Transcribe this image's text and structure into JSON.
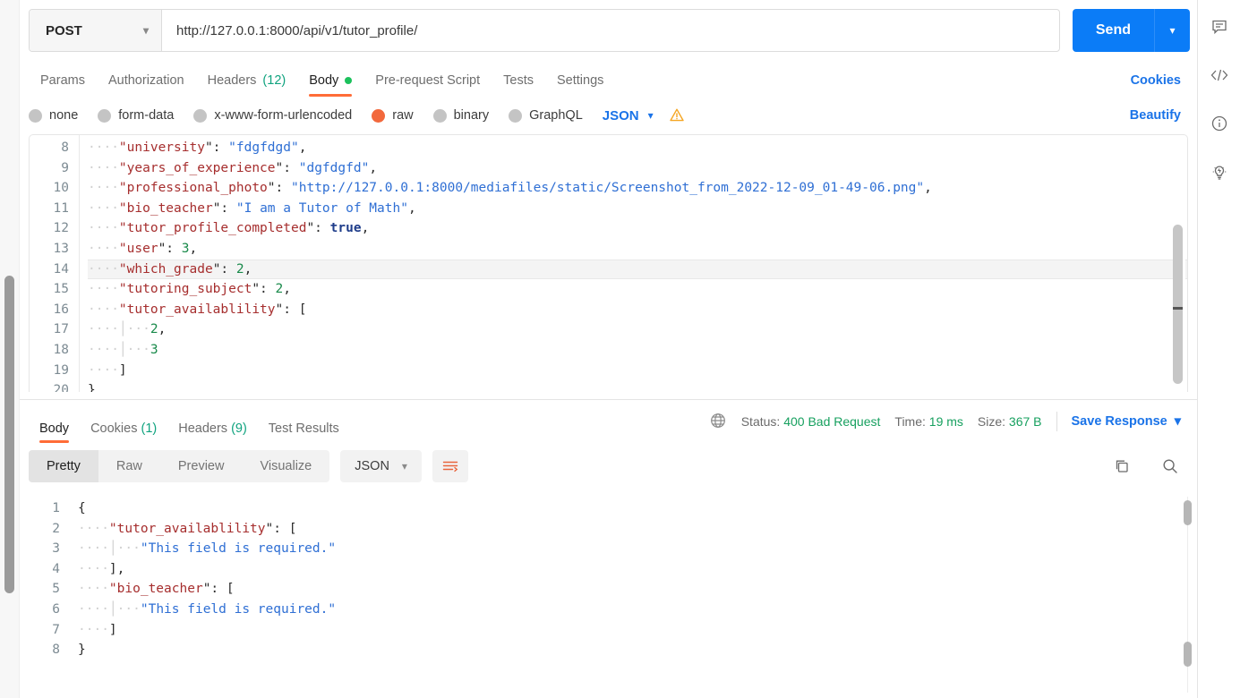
{
  "request": {
    "method": "POST",
    "url": "http://127.0.0.1:8000/api/v1/tutor_profile/",
    "send_label": "Send",
    "tabs": [
      {
        "label": "Params",
        "count": "",
        "active": false,
        "dot": false
      },
      {
        "label": "Authorization",
        "count": "",
        "active": false,
        "dot": false
      },
      {
        "label": "Headers",
        "count": "(12)",
        "active": false,
        "dot": false
      },
      {
        "label": "Body",
        "count": "",
        "active": true,
        "dot": true
      },
      {
        "label": "Pre-request Script",
        "count": "",
        "active": false,
        "dot": false
      },
      {
        "label": "Tests",
        "count": "",
        "active": false,
        "dot": false
      },
      {
        "label": "Settings",
        "count": "",
        "active": false,
        "dot": false
      }
    ],
    "cookies_link": "Cookies",
    "beautify_link": "Beautify",
    "body_types": [
      {
        "label": "none",
        "selected": false
      },
      {
        "label": "form-data",
        "selected": false
      },
      {
        "label": "x-www-form-urlencoded",
        "selected": false
      },
      {
        "label": "raw",
        "selected": true
      },
      {
        "label": "binary",
        "selected": false
      },
      {
        "label": "GraphQL",
        "selected": false
      }
    ],
    "raw_format": "JSON"
  },
  "editor": {
    "first_line": 8,
    "highlight_line": 14,
    "lines": [
      {
        "no": "8",
        "indent": 1,
        "key": "university",
        "sep": "\": ",
        "value": "\"fdgfdgd\"",
        "vtype": "s",
        "tail": ","
      },
      {
        "no": "9",
        "indent": 1,
        "key": "years_of_experience",
        "sep": "\": ",
        "value": "\"dgfdgfd\"",
        "vtype": "s",
        "tail": ","
      },
      {
        "no": "10",
        "indent": 1,
        "key": "professional_photo",
        "sep": "\": ",
        "value": "\"http://127.0.0.1:8000/mediafiles/static/Screenshot_from_2022-12-09_01-49-06.png\"",
        "vtype": "s",
        "tail": ","
      },
      {
        "no": "11",
        "indent": 1,
        "key": "bio_teacher",
        "sep": "\": ",
        "value": "\"I am a Tutor of Math\"",
        "vtype": "s",
        "tail": ","
      },
      {
        "no": "12",
        "indent": 1,
        "key": "tutor_profile_completed",
        "sep": "\": ",
        "value": "true",
        "vtype": "b",
        "tail": ","
      },
      {
        "no": "13",
        "indent": 1,
        "key": "user",
        "sep": "\": ",
        "value": "3",
        "vtype": "n",
        "tail": ","
      },
      {
        "no": "14",
        "indent": 1,
        "key": "which_grade",
        "sep": "\": ",
        "value": "2",
        "vtype": "n",
        "tail": ","
      },
      {
        "no": "15",
        "indent": 1,
        "key": "tutoring_subject",
        "sep": "\": ",
        "value": "2",
        "vtype": "n",
        "tail": ","
      },
      {
        "no": "16",
        "indent": 1,
        "key": "tutor_availablility",
        "sep": "\": ",
        "value": "[",
        "vtype": "p",
        "tail": ""
      },
      {
        "no": "17",
        "indent": 2,
        "key": "",
        "sep": "",
        "value": "2",
        "vtype": "n",
        "tail": ","
      },
      {
        "no": "18",
        "indent": 2,
        "key": "",
        "sep": "",
        "value": "3",
        "vtype": "n",
        "tail": ""
      },
      {
        "no": "19",
        "indent": 1,
        "key": "",
        "sep": "",
        "value": "]",
        "vtype": "p",
        "tail": ""
      },
      {
        "no": "20",
        "indent": 0,
        "key": "",
        "sep": "",
        "value": "}",
        "vtype": "p",
        "tail": ""
      }
    ]
  },
  "response": {
    "tabs": [
      {
        "label": "Body",
        "count": "",
        "active": true
      },
      {
        "label": "Cookies",
        "count": "(1)",
        "active": false
      },
      {
        "label": "Headers",
        "count": "(9)",
        "active": false
      },
      {
        "label": "Test Results",
        "count": "",
        "active": false
      }
    ],
    "status_label": "Status:",
    "status_value": "400 Bad Request",
    "time_label": "Time:",
    "time_value": "19 ms",
    "size_label": "Size:",
    "size_value": "367 B",
    "save_response": "Save Response",
    "view_modes": [
      {
        "label": "Pretty",
        "active": true
      },
      {
        "label": "Raw",
        "active": false
      },
      {
        "label": "Preview",
        "active": false
      },
      {
        "label": "Visualize",
        "active": false
      }
    ],
    "format": "JSON",
    "body_lines": [
      {
        "no": "1",
        "indent": 0,
        "key": "",
        "sep": "",
        "value": "{",
        "vtype": "p",
        "tail": ""
      },
      {
        "no": "2",
        "indent": 1,
        "key": "tutor_availablility",
        "sep": "\": ",
        "value": "[",
        "vtype": "p",
        "tail": ""
      },
      {
        "no": "3",
        "indent": 2,
        "key": "",
        "sep": "",
        "value": "\"This field is required.\"",
        "vtype": "s",
        "tail": ""
      },
      {
        "no": "4",
        "indent": 1,
        "key": "",
        "sep": "",
        "value": "]",
        "vtype": "p",
        "tail": ","
      },
      {
        "no": "5",
        "indent": 1,
        "key": "bio_teacher",
        "sep": "\": ",
        "value": "[",
        "vtype": "p",
        "tail": ""
      },
      {
        "no": "6",
        "indent": 2,
        "key": "",
        "sep": "",
        "value": "\"This field is required.\"",
        "vtype": "s",
        "tail": ""
      },
      {
        "no": "7",
        "indent": 1,
        "key": "",
        "sep": "",
        "value": "]",
        "vtype": "p",
        "tail": ""
      },
      {
        "no": "8",
        "indent": 0,
        "key": "",
        "sep": "",
        "value": "}",
        "vtype": "p",
        "tail": ""
      }
    ]
  },
  "rail": {
    "icons": [
      "comment-icon",
      "code-icon",
      "info-icon",
      "lightbulb-icon"
    ]
  },
  "colors": {
    "accent_orange": "#ff6c37",
    "link_blue": "#1a73e8",
    "send_blue": "#0b7cf7",
    "green": "#17a05f"
  }
}
